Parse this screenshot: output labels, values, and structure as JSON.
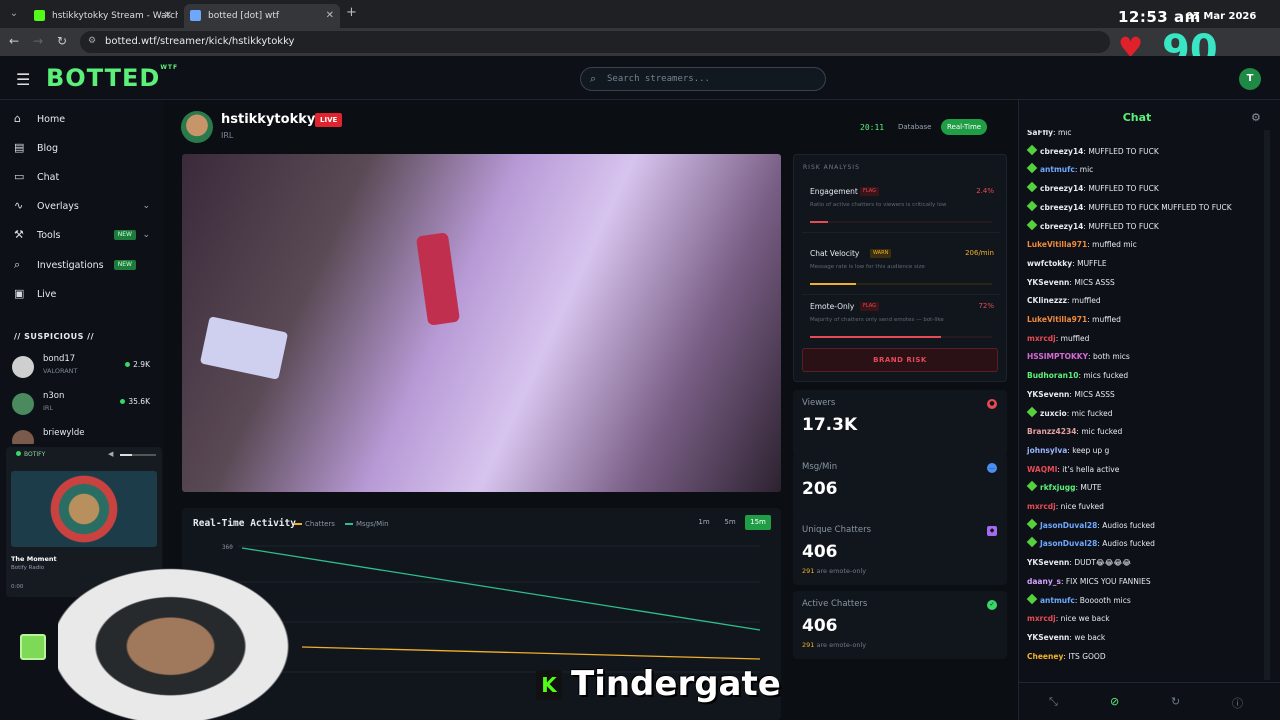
{
  "browser": {
    "tabs": [
      {
        "title": "hstikkytokky Stream - Watch Li",
        "fav_color": "#53fc18"
      },
      {
        "title": "botted [dot] wtf",
        "fav_color": "#6ea8fe"
      }
    ],
    "url": "botted.wtf/streamer/kick/hstikkytokky"
  },
  "overlay": {
    "clock": "12:53 am",
    "date": "07 Mar 2026",
    "heart_rate": "90",
    "caption": "Tindergate",
    "kick_mark": "K"
  },
  "header": {
    "logo": "BOTTED",
    "logo_sup": "WTF",
    "search_placeholder": "Search streamers...",
    "user_initial": "T"
  },
  "sidebar": {
    "items": [
      {
        "label": "Home",
        "icon": "home-icon"
      },
      {
        "label": "Blog",
        "icon": "blog-icon"
      },
      {
        "label": "Chat",
        "icon": "chat-icon"
      },
      {
        "label": "Overlays",
        "icon": "activity-icon"
      },
      {
        "label": "Tools",
        "icon": "wrench-icon",
        "badge": "NEW"
      },
      {
        "label": "Investigations",
        "icon": "search-icon",
        "badge": "NEW"
      },
      {
        "label": "Live",
        "icon": "tv-icon"
      }
    ],
    "suspicious_title": "// SUSPICIOUS //",
    "suspicious": [
      {
        "name": "bond17",
        "category": "VALORANT",
        "viewers": "2.9K"
      },
      {
        "name": "n3on",
        "category": "IRL",
        "viewers": "35.6K"
      },
      {
        "name": "briewylde",
        "category": "",
        "viewers": ""
      }
    ]
  },
  "botify": {
    "label": "BOTIFY",
    "title": "The Moment",
    "subtitle": "Botify Radio",
    "time": "0:00"
  },
  "stream": {
    "name": "hstikkytokky",
    "live_label": "LIVE",
    "category": "IRL",
    "uptime": "20:11",
    "database_label": "Database",
    "realtime_label": "Real-Time"
  },
  "activity": {
    "title": "Real-Time Activity",
    "legend_chatters": "Chatters",
    "legend_msgs": "Msgs/Min",
    "ranges": [
      "1m",
      "5m",
      "15m"
    ],
    "active_range": "15m",
    "y_top_label": "360"
  },
  "risk": {
    "header": "RISK ANALYSIS",
    "items": [
      {
        "name": "Engagement",
        "flag": "FLAG",
        "value": "2.4%",
        "desc": "Ratio of active chatters to viewers is critically low",
        "level": 0.1,
        "color": "#e64a55"
      },
      {
        "name": "Chat Velocity",
        "flag": "WARN",
        "value": "206/min",
        "desc": "Message rate is low for this audience size",
        "level": 0.25,
        "color": "#f0b02a"
      },
      {
        "name": "Emote-Only",
        "flag": "FLAG",
        "value": "72%",
        "desc": "Majority of chatters only send emotes — bot-like",
        "level": 0.72,
        "color": "#e64a55"
      }
    ],
    "brand_risk": "BRAND RISK"
  },
  "stats": {
    "viewers": {
      "label": "Viewers",
      "value": "17.3K"
    },
    "msg_min": {
      "label": "Msg/Min",
      "value": "206"
    },
    "unique": {
      "label": "Unique Chatters",
      "value": "406",
      "sub_num": "291",
      "sub_text": " are emote-only"
    },
    "active": {
      "label": "Active Chatters",
      "value": "406",
      "sub_num": "291",
      "sub_text": " are emote-only"
    }
  },
  "chat": {
    "title": "Chat",
    "messages": [
      {
        "user": "SaFfly",
        "text": "mic",
        "color": "#e6ebf0",
        "badge": false
      },
      {
        "user": "cbreezy14",
        "text": "MUFFLED TO FUCK",
        "color": "#e6ebf0",
        "badge": true
      },
      {
        "user": "antmufc",
        "text": "mic",
        "color": "#6ea8fe",
        "badge": true
      },
      {
        "user": "cbreezy14",
        "text": "MUFFLED TO FUCK",
        "color": "#e6ebf0",
        "badge": true
      },
      {
        "user": "cbreezy14",
        "text": "MUFFLED TO FUCK MUFFLED TO FUCK",
        "color": "#e6ebf0",
        "badge": true
      },
      {
        "user": "cbreezy14",
        "text": "MUFFLED TO FUCK",
        "color": "#e6ebf0",
        "badge": true
      },
      {
        "user": "LukeVitilla971",
        "text": "muffled mic",
        "color": "#f08a3c",
        "badge": false
      },
      {
        "user": "wwfctokky",
        "text": "MUFFLE",
        "color": "#e6ebf0",
        "badge": false
      },
      {
        "user": "YKSevenn",
        "text": "MICS ASSS",
        "color": "#e6ebf0",
        "badge": false
      },
      {
        "user": "CKlinezzz",
        "text": "muffled",
        "color": "#e6ebf0",
        "badge": false
      },
      {
        "user": "LukeVitilla971",
        "text": "muffled",
        "color": "#f08a3c",
        "badge": false
      },
      {
        "user": "mxrcdj",
        "text": "muffled",
        "color": "#e64a55",
        "badge": false
      },
      {
        "user": "HSSIMPTOKKY",
        "text": "both mics",
        "color": "#d66ad6",
        "badge": false
      },
      {
        "user": "Budhoran10",
        "text": "mics fucked",
        "color": "#5cf07a",
        "badge": false
      },
      {
        "user": "YKSevenn",
        "text": "MICS ASSS",
        "color": "#e6ebf0",
        "badge": false
      },
      {
        "user": "zuxcio",
        "text": "mic fucked",
        "color": "#e6ebf0",
        "badge": true
      },
      {
        "user": "Branzz4234",
        "text": "mic fucked",
        "color": "#e6a0a0",
        "badge": false
      },
      {
        "user": "johnsylva",
        "text": "keep up g",
        "color": "#9ab4ff",
        "badge": false
      },
      {
        "user": "WAQMI",
        "text": "it’s hella active",
        "color": "#e64a55",
        "badge": false
      },
      {
        "user": "rkfxjugg",
        "text": "MUTE",
        "color": "#5cf07a",
        "badge": true
      },
      {
        "user": "mxrcdj",
        "text": "nice fuvked",
        "color": "#e64a55",
        "badge": false
      },
      {
        "user": "JasonDuval28",
        "text": "Audios fucked",
        "color": "#6ea8fe",
        "badge": true
      },
      {
        "user": "JasonDuval28",
        "text": "Audios fucked",
        "color": "#6ea8fe",
        "badge": true
      },
      {
        "user": "YKSevenn",
        "text": "DUDT😂😂😂😂",
        "color": "#e6ebf0",
        "badge": false
      },
      {
        "user": "daany_s",
        "text": "FIX MICS YOU FANNIES",
        "color": "#d6a0ff",
        "badge": false
      },
      {
        "user": "antmufc",
        "text": "Booooth mics",
        "color": "#6ea8fe",
        "badge": true
      },
      {
        "user": "mxrcdj",
        "text": "nice we back",
        "color": "#e64a55",
        "badge": false
      },
      {
        "user": "YKSevenn",
        "text": "we back",
        "color": "#e6ebf0",
        "badge": false
      },
      {
        "user": "Cheeney",
        "text": "ITS GOOD",
        "color": "#f0b02a",
        "badge": false
      }
    ]
  }
}
